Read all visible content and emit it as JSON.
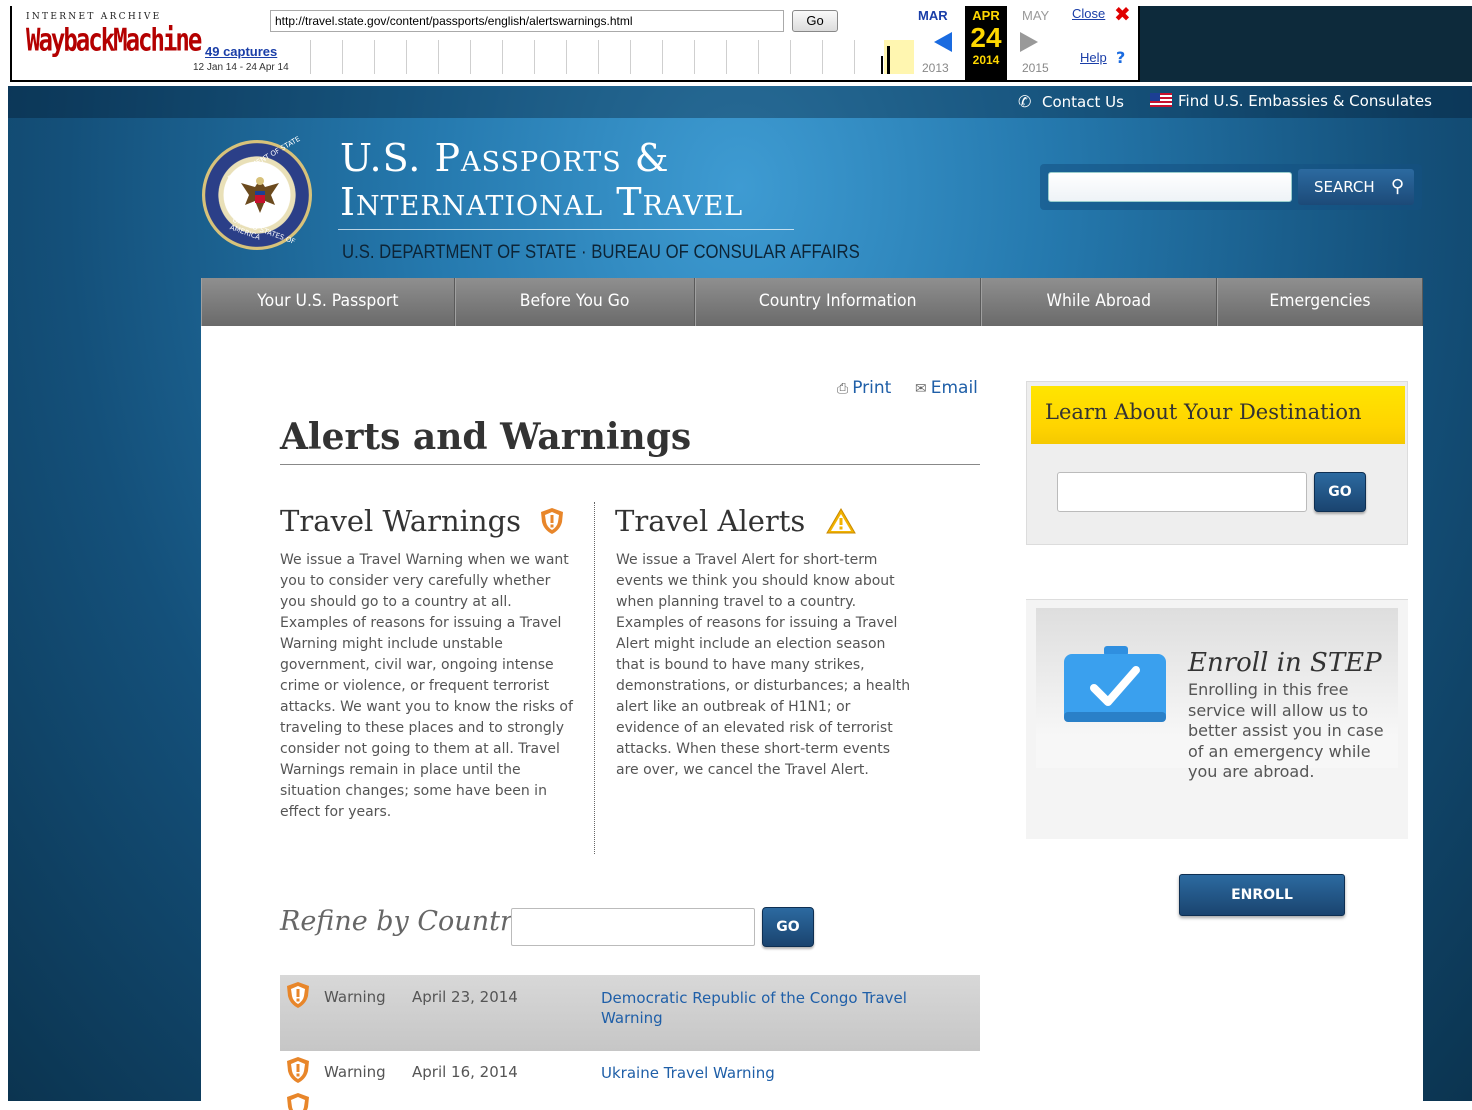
{
  "wayback": {
    "logo_top": "INTERNET ARCHIVE",
    "logo_main": "WaybackMachine",
    "url": "http://travel.state.gov/content/passports/english/alertswarnings.html",
    "go_label": "Go",
    "captures": "49 captures",
    "range": "12 Jan 14 - 24 Apr 14",
    "prev_month": "MAR",
    "cur_month": "APR",
    "next_month": "MAY",
    "cur_day": "24",
    "prev_year": "2013",
    "cur_year": "2014",
    "next_year": "2015",
    "close_label": "Close",
    "help_label": "Help"
  },
  "utility": {
    "contact": "Contact Us",
    "embassies": "Find U.S. Embassies & Consulates"
  },
  "header": {
    "title_line1": "U.S. Passports &",
    "title_line2": "International Travel",
    "subtitle": "U.S. DEPARTMENT OF STATE · BUREAU OF CONSULAR AFFAIRS",
    "seal_top": "DEPARTMENT OF STATE",
    "seal_bottom": "UNITED STATES OF AMERICA",
    "search_label": "SEARCH"
  },
  "nav": {
    "items": [
      "Your U.S. Passport",
      "Before You Go",
      "Country Information",
      "While Abroad",
      "Emergencies"
    ]
  },
  "content": {
    "print": "Print",
    "email": "Email",
    "title": "Alerts and Warnings",
    "warnings_head": "Travel Warnings",
    "warnings_text": "We issue a Travel Warning when we want you to consider very carefully whether you should go to a country at all. Examples of reasons for issuing a Travel Warning might include unstable government, civil war, ongoing intense crime or violence, or frequent terrorist attacks. We want you to know the risks of traveling to these places and to strongly consider not going to them at all. Travel Warnings remain in place until the situation changes; some have been in effect for years.",
    "alerts_head": "Travel Alerts",
    "alerts_text": "We issue a Travel Alert for short-term events we think you should know about when planning travel to a country. Examples of reasons for issuing a Travel Alert might include an election season that is bound to have many strikes, demonstrations, or disturbances; a health alert like an outbreak of H1N1; or evidence of an elevated risk of terrorist attacks. When these short-term events are over, we cancel the Travel Alert.",
    "refine_label": "Refine by Country",
    "go_label": "GO",
    "rows": [
      {
        "type": "Warning",
        "date": "April 23, 2014",
        "link": "Democratic Republic of the Congo Travel Warning"
      },
      {
        "type": "Warning",
        "date": "April 16, 2014",
        "link": "Ukraine Travel Warning"
      }
    ]
  },
  "sidebar": {
    "dest_head": "Learn About Your Destination",
    "go_label": "GO",
    "step_title": "Enroll in STEP",
    "step_text": "Enrolling in this free service will allow us to better assist you in case of an emergency while you are abroad.",
    "enroll_label": "ENROLL"
  },
  "colors": {
    "link": "#1f5fa8",
    "accent_yellow": "#ffd400",
    "button_blue": "#1a446f",
    "warning_orange": "#e8862a"
  }
}
